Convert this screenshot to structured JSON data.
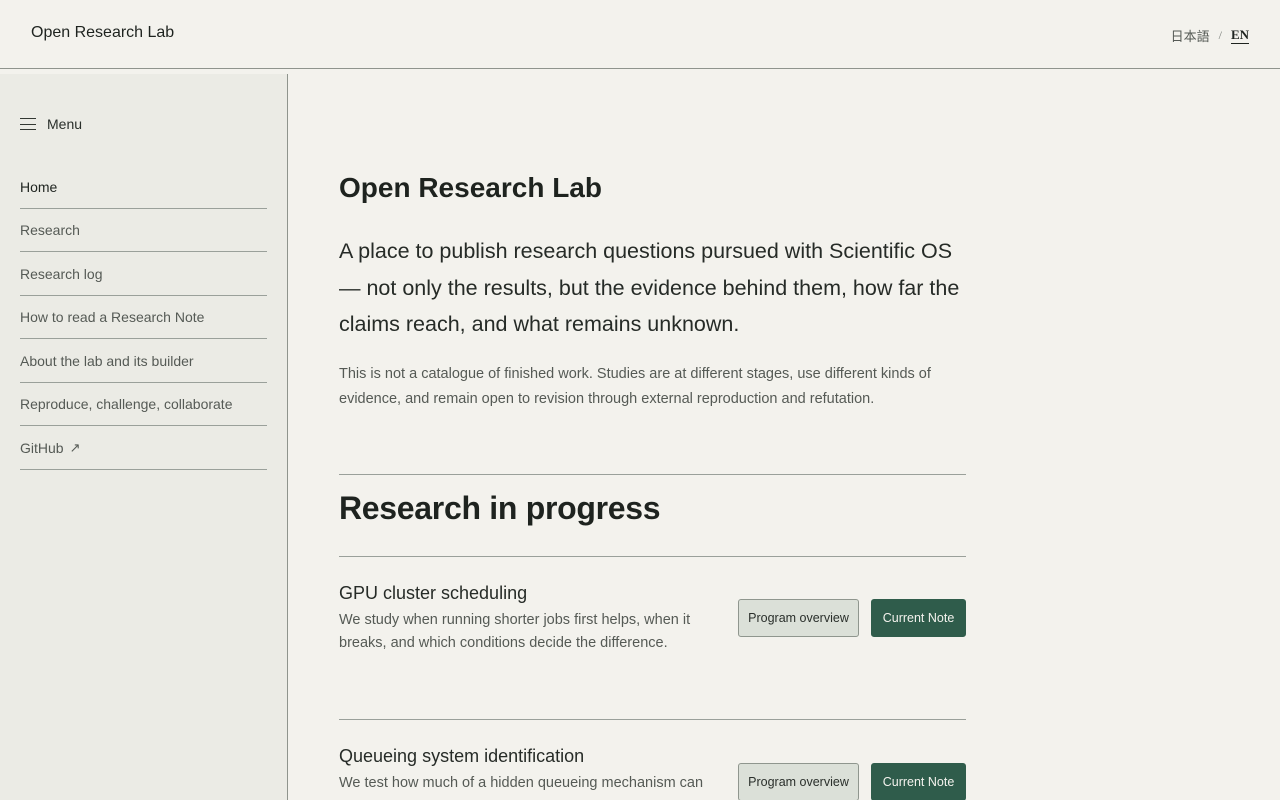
{
  "header": {
    "brand": "Open Research Lab",
    "lang_ja": "日本語",
    "lang_sep": "/",
    "lang_en": "EN"
  },
  "sidebar": {
    "menu_label": "Menu",
    "items": [
      {
        "label": "Home",
        "active": true
      },
      {
        "label": "Research"
      },
      {
        "label": "Research log"
      },
      {
        "label": "How to read a Research Note"
      },
      {
        "label": "About the lab and its builder"
      },
      {
        "label": "Reproduce, challenge, collaborate"
      },
      {
        "label": "GitHub",
        "external_icon": "↗"
      }
    ]
  },
  "main": {
    "title": "Open Research Lab",
    "lead": "A place to publish research questions pursued with Scientific OS — not only the results, but the evidence behind them, how far the claims reach, and what remains unknown.",
    "sub": "This is not a catalogue of finished work. Studies are at different stages, use different kinds of evidence, and remain open to revision through external reproduction and refutation.",
    "section_title": "Research in progress",
    "projects": [
      {
        "title": "GPU cluster scheduling",
        "description": "We study when running shorter jobs first helps, when it breaks, and which conditions decide the difference.",
        "overview_label": "Program overview",
        "note_label": "Current Note"
      },
      {
        "title": "Queueing system identification",
        "description": "We test how much of a hidden queueing mechanism can",
        "overview_label": "Program overview",
        "note_label": "Current Note"
      }
    ]
  },
  "colors": {
    "background": "#f3f2ed",
    "sidebar": "#ebebe5",
    "accent": "#2f5c4b",
    "rule": "#9aa09a"
  }
}
